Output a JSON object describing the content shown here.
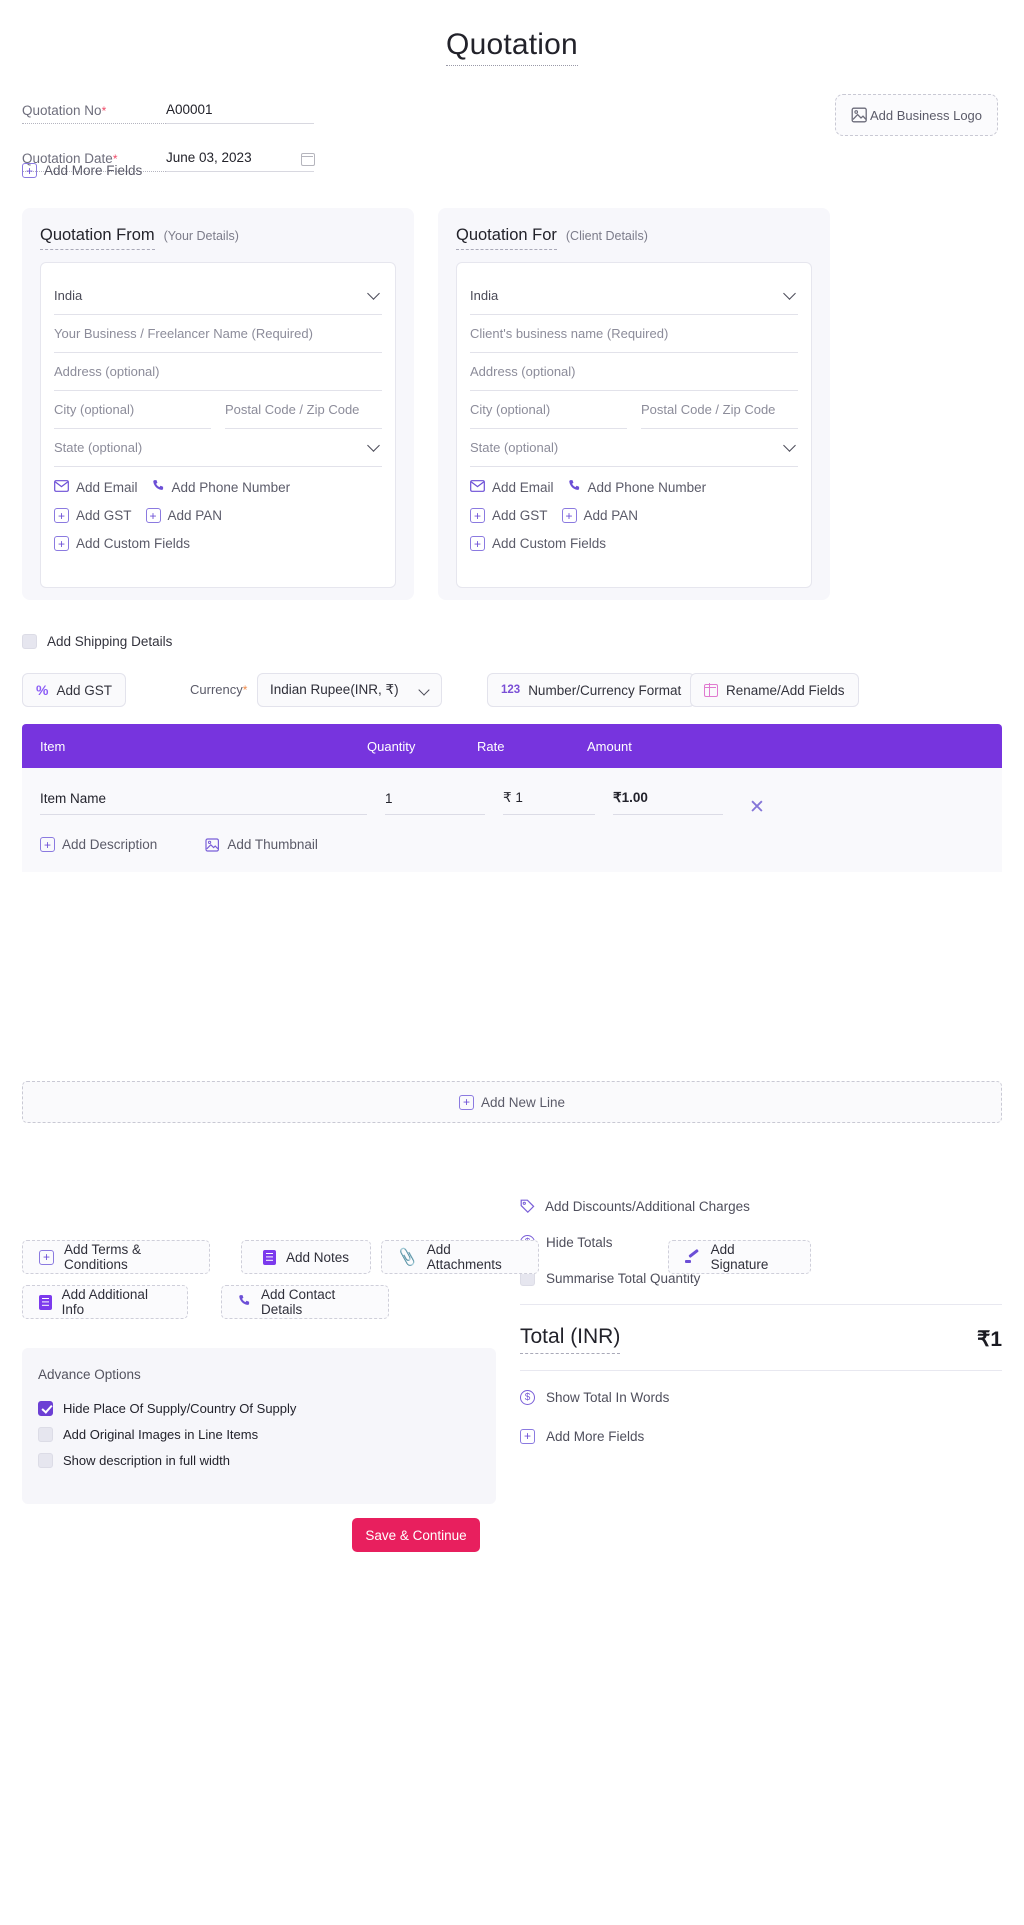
{
  "document": {
    "title": "Quotation"
  },
  "meta": {
    "number_label": "Quotation No",
    "number_required": "*",
    "number_value": "A00001",
    "date_label": "Quotation Date",
    "date_required": "*",
    "date_value": "June 03, 2023",
    "calendar_icon": "calendar-icon",
    "add_more_fields": "Add More Fields"
  },
  "logo": {
    "label": "Add Business Logo",
    "icon": "image-icon"
  },
  "party_from": {
    "heading": "Quotation From",
    "subheading": "(Your Details)",
    "country": "India",
    "name_placeholder": "Your Business / Freelancer Name (Required)",
    "address_placeholder": "Address (optional)",
    "city_placeholder": "City (optional)",
    "postal_placeholder": "Postal Code / Zip Code",
    "state_placeholder": "State (optional)",
    "add_email": "Add Email",
    "add_phone": "Add Phone Number",
    "add_gst": "Add GST",
    "add_pan": "Add PAN",
    "add_custom_fields": "Add Custom Fields"
  },
  "party_for": {
    "heading": "Quotation For",
    "subheading": "(Client Details)",
    "country": "India",
    "name_placeholder": "Client's business name (Required)",
    "address_placeholder": "Address (optional)",
    "city_placeholder": "City (optional)",
    "postal_placeholder": "Postal Code / Zip Code",
    "state_placeholder": "State (optional)",
    "add_email": "Add Email",
    "add_phone": "Add Phone Number",
    "add_gst": "Add GST",
    "add_pan": "Add PAN",
    "add_custom_fields": "Add Custom Fields"
  },
  "shipping": {
    "label": "Add Shipping Details",
    "checked": false
  },
  "toolbar": {
    "add_gst": "Add GST",
    "currency_label": "Currency",
    "currency_required": "*",
    "currency_value": "Indian Rupee(INR, ₹)",
    "number_format": "Number/Currency Format",
    "rename_add_fields": "Rename/Add Fields"
  },
  "items_table": {
    "columns": [
      "Item",
      "Quantity",
      "Rate",
      "Amount"
    ],
    "rows": [
      {
        "item": "Item Name",
        "quantity": "1",
        "rate": "₹ 1",
        "amount": "₹1.00",
        "remove_icon": "close-icon"
      }
    ],
    "add_description": "Add Description",
    "add_thumbnail": "Add Thumbnail",
    "add_new_line": "Add New Line",
    "header_color": "#7734de"
  },
  "totals": {
    "add_discounts": "Add Discounts/Additional Charges",
    "hide_totals": "Hide Totals",
    "summarise_total_quantity": "Summarise Total Quantity",
    "summarise_checked": false,
    "total_label": "Total (INR)",
    "total_value": "₹1",
    "show_total_in_words": "Show Total In Words",
    "add_more_fields": "Add More Fields"
  },
  "actions": {
    "terms": "Add Terms & Conditions",
    "notes": "Add Notes",
    "attachments": "Add Attachments",
    "signature": "Add Signature",
    "additional_info": "Add Additional Info",
    "contact_details": "Add Contact Details"
  },
  "advance_options": {
    "heading": "Advance Options",
    "items": [
      {
        "label": "Hide Place Of Supply/Country Of Supply",
        "checked": true
      },
      {
        "label": "Add Original Images in Line Items",
        "checked": false
      },
      {
        "label": "Show description in full width",
        "checked": false
      }
    ]
  },
  "footer": {
    "save_label": "Save & Continue",
    "save_color": "#e81f5e"
  }
}
